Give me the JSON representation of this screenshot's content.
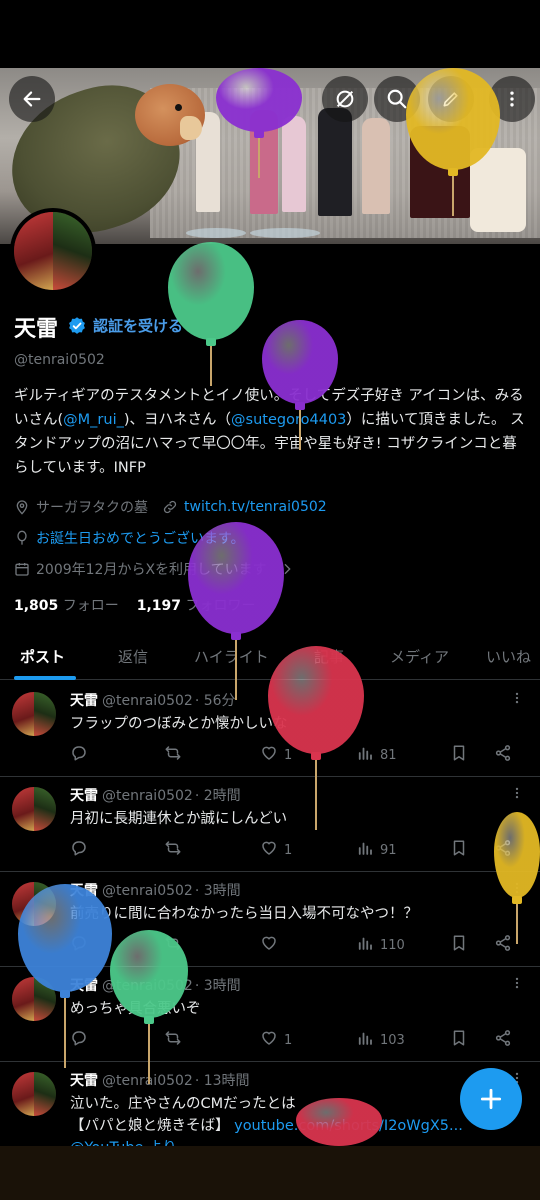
{
  "profile": {
    "name": "天雷",
    "verify_label": "認証を受ける",
    "handle": "@tenrai0502",
    "bio_part1": "ギルティギアのテスタメントとイノ使い。そしてデズ子好き アイコンは、みるいさん(",
    "bio_link1": "@M_rui_",
    "bio_part2": ")、ヨハネさん（",
    "bio_link2": "@sutegoro4403",
    "bio_part3": "）に描いて頂きました。 スタンドアップの沼にハマって早〇〇年。宇宙や星も好き! コザクラインコと暮らしています。INFP",
    "location": "サーガヲタクの墓",
    "website": "twitch.tv/tenrai0502",
    "birthday": "お誕生日おめでとうございます。",
    "joined": "2009年12月からXを利用しています",
    "following_count": "1,805",
    "following_label": "フォロー",
    "followers_count": "1,197",
    "followers_label": "フォロワー"
  },
  "tabs": [
    "ポスト",
    "返信",
    "ハイライト",
    "記事",
    "メディア",
    "いいね"
  ],
  "posts": [
    {
      "name": "天雷",
      "handle": "@tenrai0502",
      "time": "· 56分",
      "text": "フラップのつぼみとか懐かしいな",
      "likes": "1",
      "views": "81"
    },
    {
      "name": "天雷",
      "handle": "@tenrai0502",
      "time": "· 2時間",
      "text": "月初に長期連休とか誠にしんどい",
      "likes": "1",
      "views": "91"
    },
    {
      "name": "天雷",
      "handle": "@tenrai0502",
      "time": "· 3時間",
      "text": "前売りに間に合わなかったら当日入場不可なやつ！？",
      "likes": "",
      "views": "110"
    },
    {
      "name": "天雷",
      "handle": "@tenrai0502",
      "time": "· 3時間",
      "text": "めっちゃ具合悪いぞ",
      "likes": "1",
      "views": "103"
    },
    {
      "name": "天雷",
      "handle": "@tenrai0502",
      "time": "· 13時間",
      "text": "泣いた。庄やさんのCMだったとは",
      "text2": "【パパと娘と焼きそば】",
      "link": "youtube.com/shorts/I2oWgX5...",
      "text3": "@YouTube より"
    }
  ],
  "colors": {
    "accent": "#1d9bf0",
    "balloon_green": "#4cc98a",
    "balloon_purple": "#8a2fd0",
    "balloon_red": "#d9344e",
    "balloon_yellow": "#e2b824",
    "balloon_blue": "#3d83d9"
  }
}
